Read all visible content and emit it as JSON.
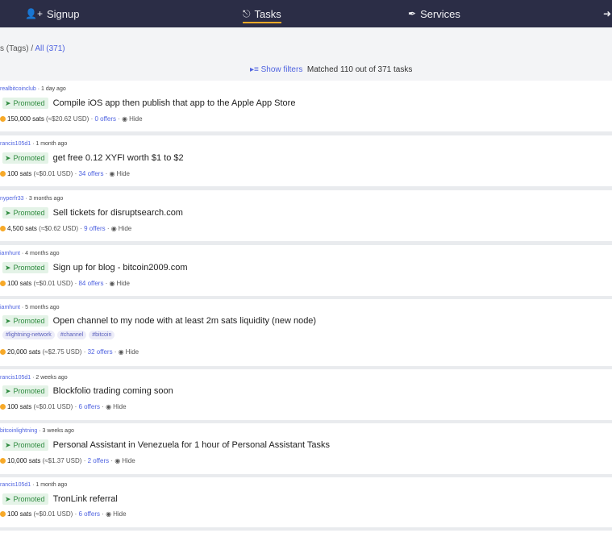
{
  "nav": {
    "signup": "Signup",
    "tasks": "Tasks",
    "services": "Services"
  },
  "breadcrumb": {
    "prefix": "s (Tags) / ",
    "current": "All (371)"
  },
  "filters": {
    "show": "Show filters",
    "matched": "Matched 110 out of 371 tasks"
  },
  "labels": {
    "promoted": "Promoted",
    "hide": "Hide"
  },
  "tasks": [
    {
      "user": "realbitcoinclub",
      "age": "1 day ago",
      "title": "Compile iOS app then publish that app to the Apple App Store",
      "sats": "150,000 sats",
      "usd": "(≈$20.62 USD)",
      "offers": "0 offers"
    },
    {
      "user": "rancis105d1",
      "age": "1 month ago",
      "title": "get free 0.12 XYFI worth $1 to $2",
      "sats": "100 sats",
      "usd": "(≈$0.01 USD)",
      "offers": "34 offers"
    },
    {
      "user": "nyperfr33",
      "age": "3 months ago",
      "title": "Sell tickets for disruptsearch.com",
      "sats": "4,500 sats",
      "usd": "(≈$0.62 USD)",
      "offers": "9 offers"
    },
    {
      "user": "iamhunt",
      "age": "4 months ago",
      "title": "Sign up for blog - bitcoin2009.com",
      "sats": "100 sats",
      "usd": "(≈$0.01 USD)",
      "offers": "84 offers"
    },
    {
      "user": "iamhunt",
      "age": "5 months ago",
      "title": "Open channel to my node with at least 2m sats liquidity (new node)",
      "tags": [
        "#lightning-network",
        "#channel",
        "#bitcoin"
      ],
      "sats": "20,000 sats",
      "usd": "(≈$2.75 USD)",
      "offers": "32 offers"
    },
    {
      "user": "rancis105d1",
      "age": "2 weeks ago",
      "title": "Blockfolio trading coming soon",
      "sats": "100 sats",
      "usd": "(≈$0.01 USD)",
      "offers": "6 offers"
    },
    {
      "user": "bitcoinlightning",
      "age": "3 weeks ago",
      "title": "Personal Assistant in Venezuela for 1 hour of Personal Assistant Tasks",
      "sats": "10,000 sats",
      "usd": "(≈$1.37 USD)",
      "offers": "2 offers"
    },
    {
      "user": "rancis105d1",
      "age": "1 month ago",
      "title": "TronLink referral",
      "sats": "100 sats",
      "usd": "(≈$0.01 USD)",
      "offers": "6 offers"
    }
  ]
}
